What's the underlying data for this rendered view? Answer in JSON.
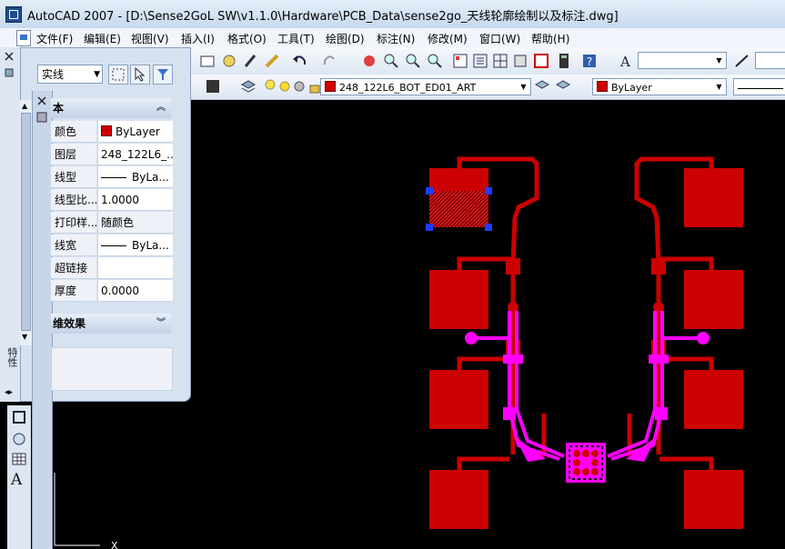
{
  "window": {
    "title": "AutoCAD 2007 - [D:\\Sense2GoL SW\\v1.1.0\\Hardware\\PCB_Data\\sense2go_天线轮廓绘制以及标注.dwg]"
  },
  "menubar": {
    "items": [
      "文件(F)",
      "编辑(E)",
      "视图(V)",
      "插入(I)",
      "格式(O)",
      "工具(T)",
      "绘图(D)",
      "标注(N)",
      "修改(M)",
      "窗口(W)",
      "帮助(H)"
    ]
  },
  "toolbar": {
    "layer_combo": "248_122L6_BOT_ED01_ART",
    "color_combo": "ByLayer"
  },
  "properties_panel": {
    "linetype_filter": "实线",
    "section_general": "本",
    "rows": [
      {
        "label": "颜色",
        "value": "ByLayer"
      },
      {
        "label": "图层",
        "value": "248_122L6_..."
      },
      {
        "label": "线型",
        "value": "ByLa..."
      },
      {
        "label": "线型比...",
        "value": "1.0000"
      },
      {
        "label": "打印样...",
        "value": "随颜色"
      },
      {
        "label": "线宽",
        "value": "ByLa..."
      },
      {
        "label": "超链接",
        "value": ""
      },
      {
        "label": "厚度",
        "value": "0.0000"
      }
    ],
    "section_3d": "维效果",
    "side_tab_label": "特性"
  },
  "colors": {
    "trace_red": "#cc0000",
    "trace_magenta": "#ff00ff",
    "grip_blue": "#1e3cff",
    "canvas": "#000000"
  }
}
